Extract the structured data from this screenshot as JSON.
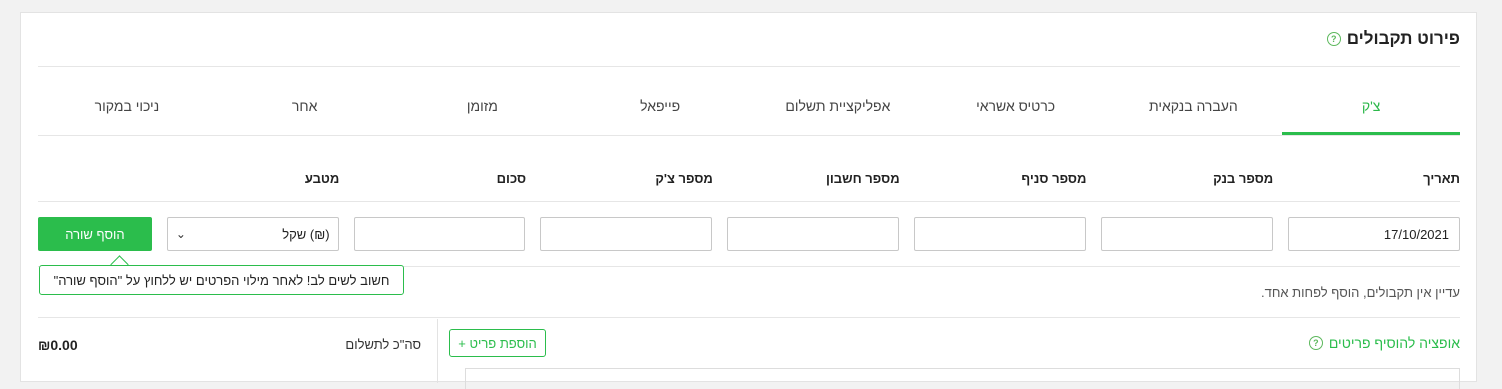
{
  "header": {
    "title": "פירוט תקבולים",
    "help_icon": "?"
  },
  "tabs": [
    {
      "label": "צ'ק",
      "active": true
    },
    {
      "label": "העברה בנקאית",
      "active": false
    },
    {
      "label": "כרטיס אשראי",
      "active": false
    },
    {
      "label": "אפליקציית תשלום",
      "active": false
    },
    {
      "label": "פייפאל",
      "active": false
    },
    {
      "label": "מזומן",
      "active": false
    },
    {
      "label": "אחר",
      "active": false
    },
    {
      "label": "ניכוי במקור",
      "active": false
    }
  ],
  "columns": [
    "תאריך",
    "מספר בנק",
    "מספר סניף",
    "מספר חשבון",
    "מספר צ'ק",
    "סכום",
    "מטבע"
  ],
  "fields": {
    "date": "17/10/2021",
    "bank_number": "",
    "branch_number": "",
    "account_number": "",
    "check_number": "",
    "amount": "",
    "currency": "שקל (₪)",
    "currency_chevron": "⌄"
  },
  "add_row_button": "הוסף שורה",
  "tooltip": "חשוב לשים לב! לאחר מילוי הפרטים יש ללחוץ על \"הוסף שורה\"",
  "empty_message": "עדיין אין תקבולים, הוסף לפחות אחד.",
  "totals": {
    "label": "סה\"כ לתשלום",
    "amount": "₪0.00"
  },
  "add_item_button": "הוספת פריט +",
  "add_items_option": "אופציה להוסיף פריטים",
  "colors": {
    "accent": "#2bbd4c"
  }
}
